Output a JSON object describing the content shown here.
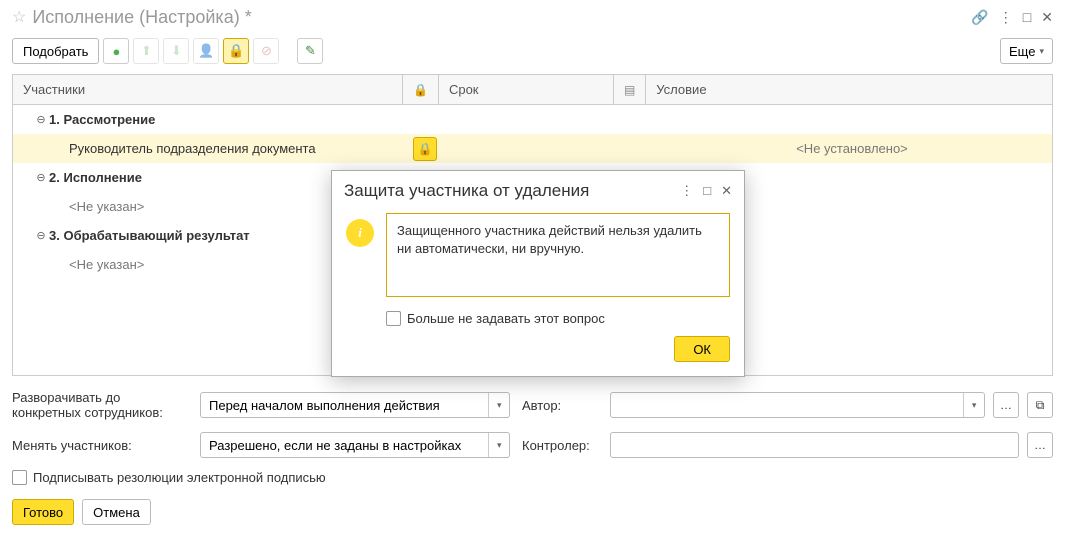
{
  "header": {
    "title": "Исполнение (Настройка) *"
  },
  "toolbar": {
    "pick": "Подобрать",
    "more": "Еще"
  },
  "table": {
    "col_participants": "Участники",
    "col_deadline": "Срок",
    "col_condition": "Условие",
    "groups": [
      {
        "num": "1.",
        "label": "Рассмотрение"
      },
      {
        "num": "2.",
        "label": "Исполнение"
      },
      {
        "num": "3.",
        "label": "Обрабатывающий результат"
      }
    ],
    "row1_participant": "Руководитель подразделения документа",
    "row1_condition": "<Не установлено>",
    "not_specified": "<Не указан>"
  },
  "form": {
    "expand_label": "Разворачивать до конкретных сотрудников:",
    "expand_value": "Перед началом выполнения действия",
    "author_label": "Автор:",
    "change_label": "Менять участников:",
    "change_value": "Разрешено, если не заданы в настройках",
    "controller_label": "Контролер:",
    "sign_checkbox": "Подписывать резолюции электронной подписью",
    "ready": "Готово",
    "cancel": "Отмена"
  },
  "dialog": {
    "title": "Защита участника от удаления",
    "message": "Защищенного участника действий нельзя удалить ни автоматически, ни вручную.",
    "dont_ask": "Больше не задавать этот вопрос",
    "ok": "ОК"
  }
}
